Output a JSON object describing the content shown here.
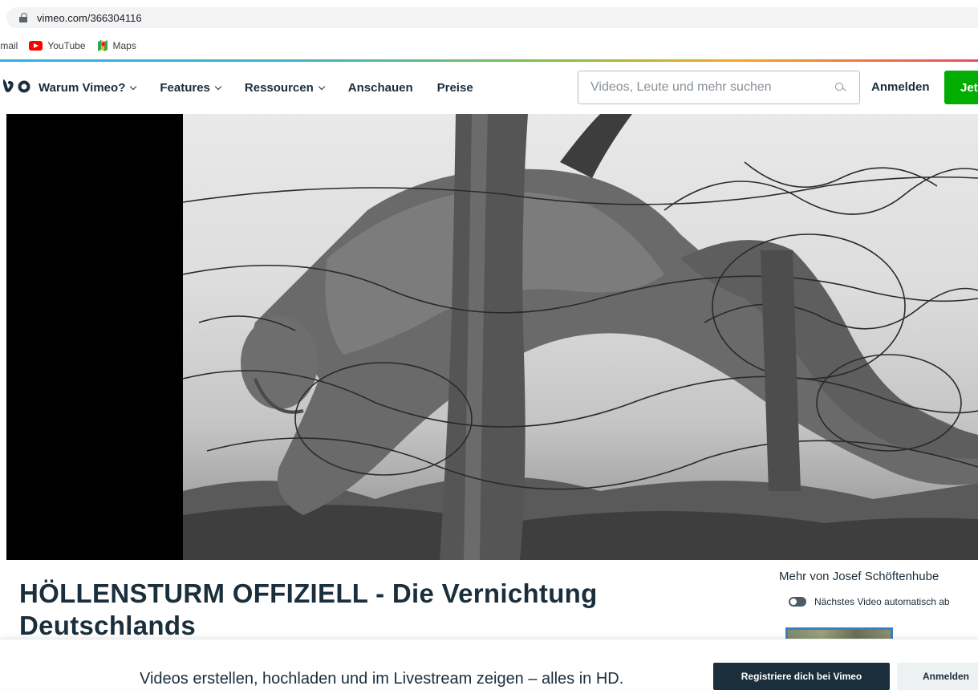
{
  "browser": {
    "url": "vimeo.com/366304116",
    "bookmarks": [
      {
        "label": "Gmail",
        "icon": "gmail-icon"
      },
      {
        "label": "YouTube",
        "icon": "youtube-icon"
      },
      {
        "label": "Maps",
        "icon": "maps-icon"
      }
    ]
  },
  "nav": {
    "logo": "vimeo",
    "items": [
      {
        "label": "Warum Vimeo?",
        "dropdown": true
      },
      {
        "label": "Features",
        "dropdown": true
      },
      {
        "label": "Ressourcen",
        "dropdown": true
      },
      {
        "label": "Anschauen",
        "dropdown": false
      },
      {
        "label": "Preise",
        "dropdown": false
      }
    ],
    "search_placeholder": "Videos, Leute und mehr suchen",
    "login": "Anmelden",
    "join": "Jet"
  },
  "video": {
    "title": "HÖLLENSTURM OFFIZIELL - Die Vernichtung Deutschlands"
  },
  "sidebar": {
    "more_from": "Mehr von Josef Schöftenhube",
    "autoplay_label": "Nächstes Video automatisch ab",
    "autoplay_on": false
  },
  "banner": {
    "text": "Videos erstellen, hochladen und im Livestream zeigen – alles in HD.",
    "register": "Registriere dich bei Vimeo",
    "login": "Anmelden"
  },
  "colors": {
    "brand_dark": "#1a2e3b",
    "join_green": "#00ad00"
  }
}
